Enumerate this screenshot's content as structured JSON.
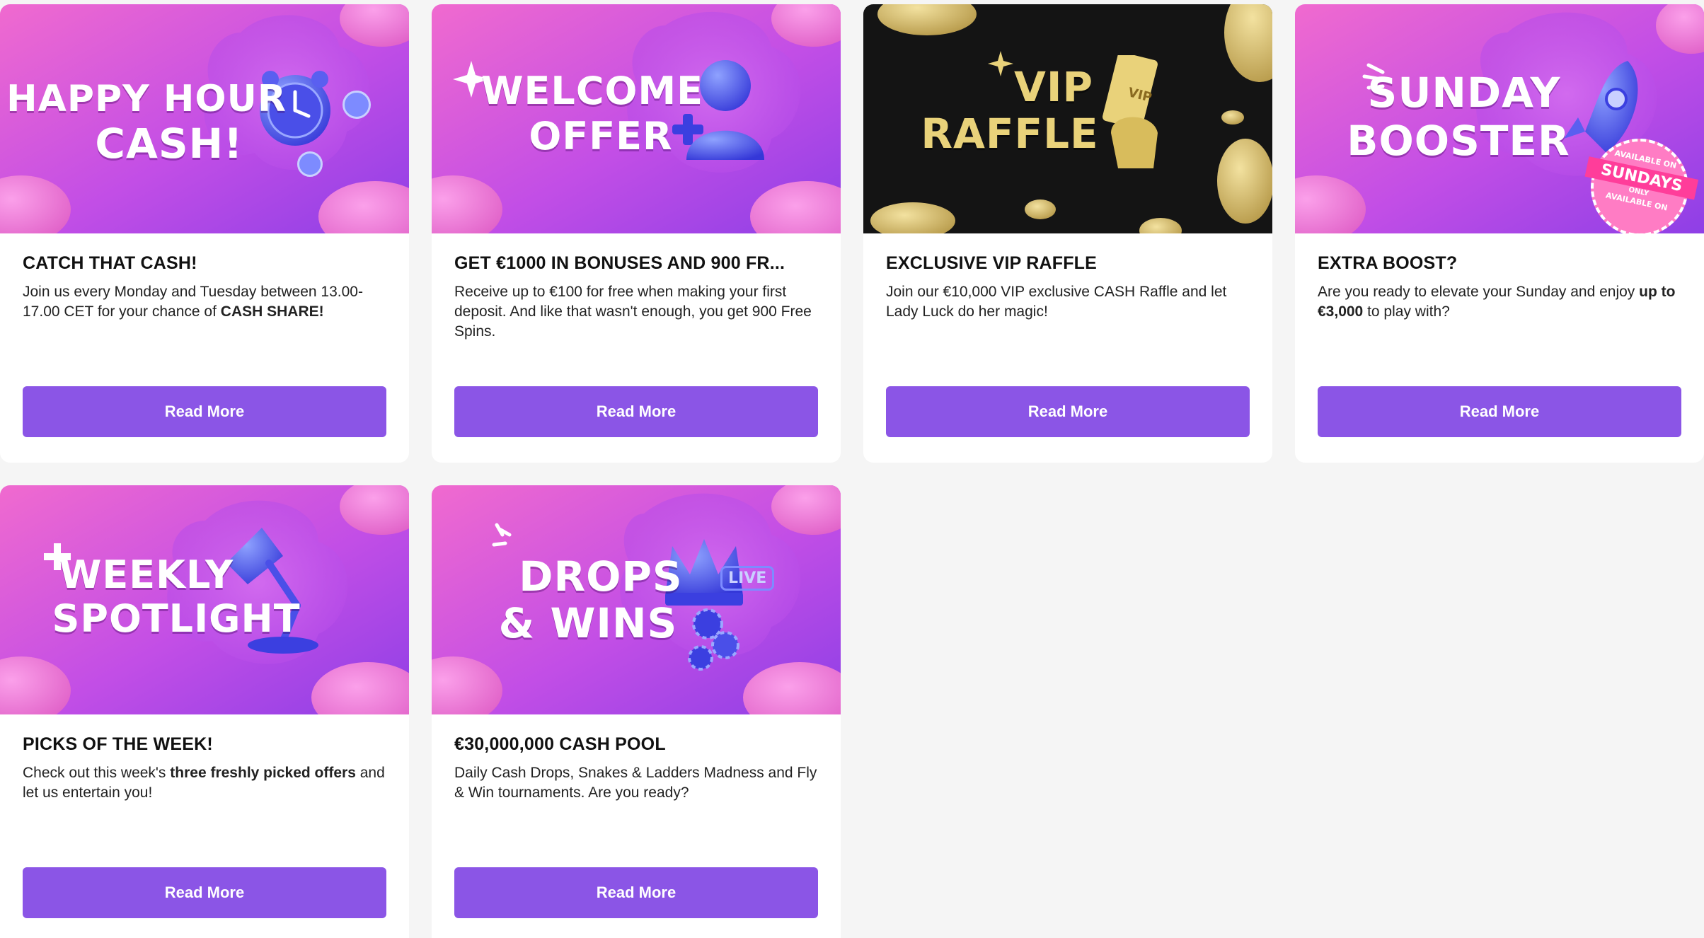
{
  "colors": {
    "page_bg": "#f5f5f5",
    "button": "#8b55e6",
    "banner_pink": "#ee5fd0",
    "banner_purple": "#a040e8",
    "vip_bg": "#111111",
    "vip_gold": "#e9d27a"
  },
  "promotions": [
    {
      "banner_line1": "HAPPY HOUR",
      "banner_line2": "CASH!",
      "banner_icon": "alarm-clock-icon",
      "title": "CATCH THAT CASH!",
      "desc_pre": "Join us every Monday and Tuesday between 13.00-17.00 CET for your chance of ",
      "desc_bold": "CASH SHARE!",
      "desc_post": "",
      "button": "Read More"
    },
    {
      "banner_line1": "WELCOME",
      "banner_line2": "OFFER",
      "banner_icon": "user-add-icon",
      "title": "GET €1000 IN BONUSES AND 900 FR...",
      "desc_pre": "Receive up to €100 for free when making your first deposit. And like that wasn't enough, you get 900 Free Spins.",
      "desc_bold": "",
      "desc_post": "",
      "button": "Read More"
    },
    {
      "banner_line1": "VIP",
      "banner_line2": "RAFFLE",
      "banner_icon": "vip-ticket-icon",
      "banner_ticket_text": "VIP",
      "title": "EXCLUSIVE VIP RAFFLE",
      "desc_pre": "Join our €10,000 VIP exclusive CASH Raffle and let Lady Luck do her magic!",
      "desc_bold": "",
      "desc_post": "",
      "button": "Read More"
    },
    {
      "banner_line1": "SUNDAY",
      "banner_line2": "BOOSTER",
      "banner_icon": "rocket-icon",
      "banner_stamp_top": "AVAILABLE ON",
      "banner_stamp_main": "SUNDAYS",
      "banner_stamp_sub": "ONLY",
      "banner_stamp_bottom": "AVAILABLE ON",
      "title": "EXTRA BOOST?",
      "desc_pre": "Are you ready to elevate your Sunday and enjoy ",
      "desc_bold": "up to €3,000",
      "desc_post": " to play with?",
      "button": "Read More"
    },
    {
      "banner_line1": "WEEKLY",
      "banner_line2": "SPOTLIGHT",
      "banner_icon": "desk-lamp-icon",
      "title": "PICKS OF THE WEEK!",
      "desc_pre": "Check out this week's ",
      "desc_bold": "three freshly picked offers",
      "desc_post": " and let us entertain you!",
      "button": "Read More"
    },
    {
      "banner_line1": "DROPS",
      "banner_line2": "& WINS",
      "banner_icon": "crown-icon",
      "banner_live_badge": "LIVE",
      "title": "€30,000,000 CASH POOL",
      "desc_pre": "Daily Cash Drops, Snakes & Ladders Madness and Fly & Win tournaments. Are you ready?",
      "desc_bold": "",
      "desc_post": "",
      "button": "Read More"
    }
  ]
}
